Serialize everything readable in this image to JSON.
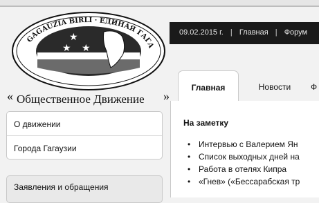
{
  "logo": {
    "seal_text": "GAGAUZIA BIRLI · ЕДИНАЯ ГАГАУЗИЯ · GAGAUZIA UNITARA · BIRLIK",
    "tagline": "Общественное Движение",
    "quote_open": "«",
    "quote_close": "»"
  },
  "topbar": {
    "date": "09.02.2015 г.",
    "links": [
      "Главная",
      "Форум"
    ]
  },
  "tabs": [
    "Главная",
    "Новости",
    "Ф"
  ],
  "sidebar": {
    "items": [
      "О движении",
      "Города Гагаузии"
    ],
    "section_title": "Заявления и обращения"
  },
  "main": {
    "heading": "На заметку",
    "list": [
      "Интервью с Валерием Ян",
      "Список выходных дней на",
      "Работа в отелях Кипра",
      "«Гнев» («Бессарабская тр"
    ]
  },
  "colors": {
    "dark_bar": "#1a1a1a",
    "page_bg": "#f2f2f2",
    "panel_bg": "#ffffff"
  }
}
